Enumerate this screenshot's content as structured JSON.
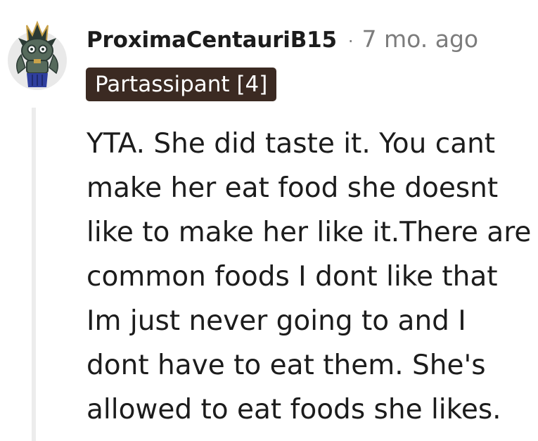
{
  "comment": {
    "author": "ProximaCentauriB15",
    "separator": "·",
    "age": "7 mo. ago",
    "flair": "Partassipant [4]",
    "body_lines": [
      "YTA. She did taste it. You cant",
      "make her eat food she doesnt",
      "like to make her like it.There are",
      "common foods I dont like that",
      "Im just never going to and I",
      "dont have to eat them. She's",
      "allowed to eat foods she likes."
    ]
  },
  "avatar": {
    "icon": "snoo-avatar-icon",
    "colors": {
      "background": "#e9e9e9",
      "armor": "#566a5c",
      "armor_dark": "#2b3a34",
      "gold": "#c9a24a",
      "cape": "#2f3f9e"
    }
  },
  "colors": {
    "text": "#1c1c1c",
    "muted": "#7c7c7c",
    "flair_background": "#3b2a22",
    "flair_text": "#ffffff",
    "thread_line": "#ececec"
  }
}
